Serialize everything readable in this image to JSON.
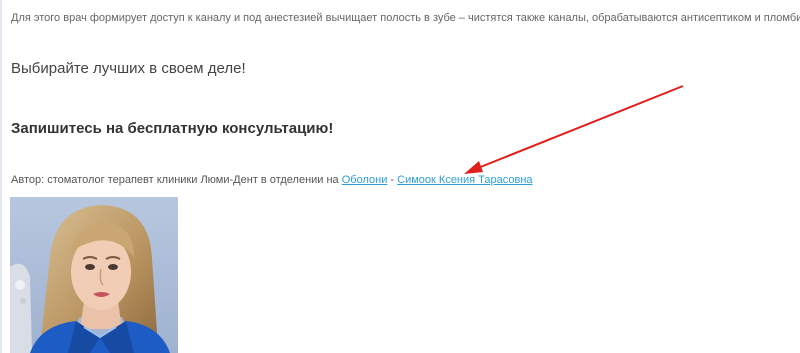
{
  "article": {
    "cut_top_line": "— — — — — — — — — — — — — — — — — — — — — — — — — — — — —",
    "paragraph": "Для этого врач формирует доступ к каналу и под анестезией вычищает полость в зубе – чистятся также каналы, обрабатываются антисептиком и пломбируются.",
    "subheading": "Выбирайте лучших в своем деле!",
    "cta": "Запишитесь на бесплатную консультацию!",
    "author": {
      "prefix": "Автор: стоматолог терапевт клиники Люми-Дент в отделении на ",
      "location_link": "Оболони",
      "separator": " - ",
      "doctor_link": "Симоок Ксения Тарасовна"
    },
    "photo_icon": "doctor-portrait-photo"
  },
  "annotation": {
    "arrow_color": "#e0201b"
  },
  "colors": {
    "link": "#2e9fd6",
    "photo_background": "#a9bbd6",
    "uniform": "#1d5cc4"
  }
}
